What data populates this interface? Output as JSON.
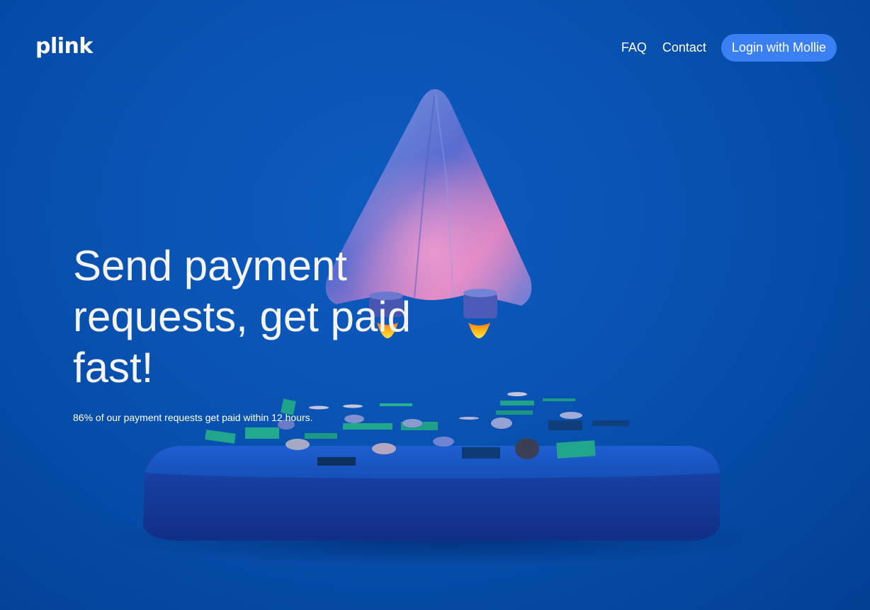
{
  "header": {
    "logo": "plink",
    "nav": {
      "faq": "FAQ",
      "contact": "Contact",
      "login": "Login with Mollie"
    }
  },
  "hero": {
    "headline": "Send payment requests, get paid fast!",
    "subtext": "86% of our payment requests get paid within 12 hours."
  },
  "colors": {
    "background": "#0a54b4",
    "login_button": "#3a7ff3",
    "text": "#ffffff"
  }
}
